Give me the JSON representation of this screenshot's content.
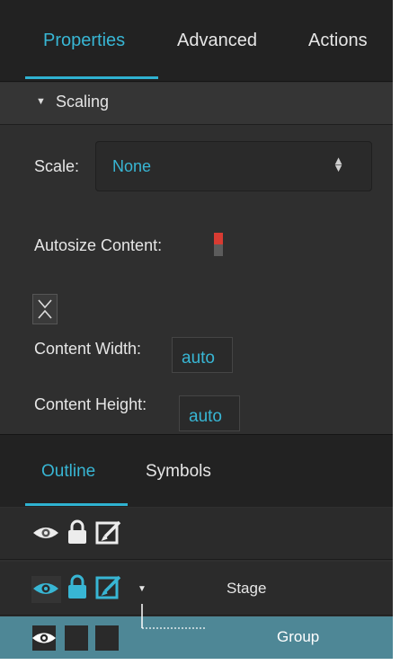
{
  "tabs": {
    "properties": "Properties",
    "advanced": "Advanced",
    "actions": "Actions"
  },
  "section": {
    "title": "Scaling"
  },
  "scale": {
    "label": "Scale:",
    "value": "None"
  },
  "autosize": {
    "label": "Autosize Content:",
    "enabled": true
  },
  "content_width": {
    "label": "Content Width:",
    "value": "auto"
  },
  "content_height": {
    "label": "Content Height:",
    "value": "auto"
  },
  "outline_tabs": {
    "outline": "Outline",
    "symbols": "Symbols"
  },
  "tree": {
    "items": [
      {
        "label": "Stage"
      },
      {
        "label": "Group"
      }
    ]
  },
  "colors": {
    "accent": "#38b6d4",
    "toggle_on": "#d83b32",
    "selected_row": "#4e8796"
  }
}
